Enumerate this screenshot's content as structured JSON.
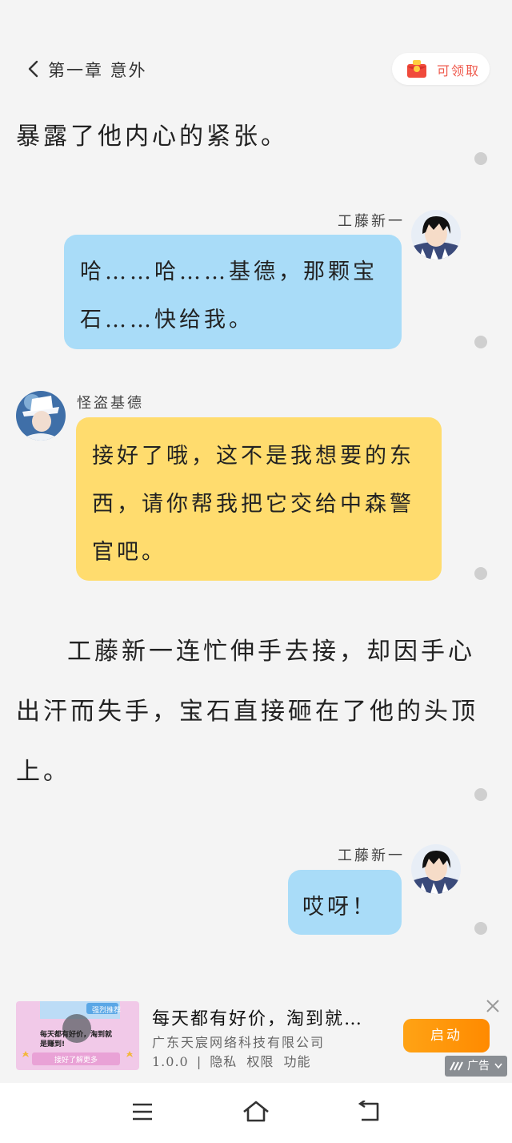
{
  "header": {
    "chapter_title": "第一章 意外",
    "reward_label": "可领取"
  },
  "content": {
    "para1": "暴露了他内心的紧张。",
    "msg1": {
      "sender": "工藤新一",
      "lines": [
        "哈……哈……基德，那颗宝",
        "石……快给我。"
      ]
    },
    "msg2": {
      "sender": "怪盗基德",
      "lines": [
        "接好了哦，这不是我想要的东",
        "西，请你帮我把它交给中森警",
        "官吧。"
      ]
    },
    "para2": [
      "工藤新一连忙伸手去接，却因手心",
      "出汗而失手，宝石直接砸在了他的头顶",
      "上。"
    ],
    "msg3": {
      "sender": "工藤新一",
      "lines": [
        "哎呀！"
      ]
    }
  },
  "ad": {
    "image_text": [
      "每天都有好价，淘到就是赚到!",
      "强烈推荐",
      "接好了解更多"
    ],
    "title": "每天都有好价，淘到就…",
    "company": "广东天宸网络科技有限公司",
    "version": "1.0.0",
    "links": [
      "隐私",
      "权限",
      "功能"
    ],
    "button": "启动",
    "tag": "广告"
  },
  "colors": {
    "blue_bubble": "#a9dcf8",
    "yellow_bubble": "#ffdc6e",
    "ad_button": "#ff9800",
    "reward_text": "#ef5a4d"
  }
}
